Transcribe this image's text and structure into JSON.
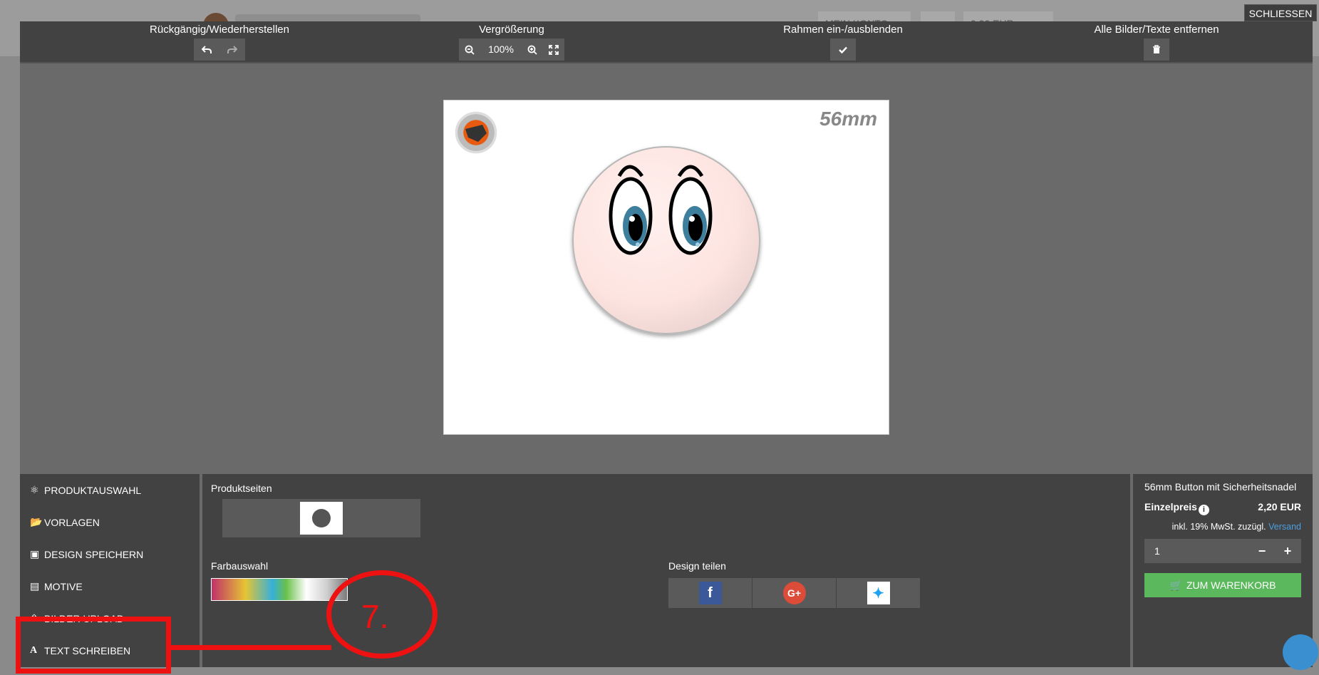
{
  "site": {
    "nav_account": "MEIN KONTO",
    "nav_cart": "0,00 EUR"
  },
  "close_label": "SCHLIESSEN",
  "toolbar": {
    "undo_redo_label": "Rückgängig/Wiederherstellen",
    "zoom_label": "Vergrößerung",
    "zoom_value": "100%",
    "frame_label": "Rahmen ein-/ausblenden",
    "clear_label": "Alle Bilder/Texte entfernen"
  },
  "canvas": {
    "size_label": "56mm"
  },
  "menu": {
    "items": [
      {
        "label": "PRODUKTAUSWAHL",
        "icon": "cubes-icon"
      },
      {
        "label": "VORLAGEN",
        "icon": "folder-open-icon"
      },
      {
        "label": "DESIGN SPEICHERN",
        "icon": "floppy-icon"
      },
      {
        "label": "MOTIVE",
        "icon": "image-icon"
      },
      {
        "label": "BILDER UPLOAD",
        "icon": "upload-icon"
      },
      {
        "label": "TEXT SCHREIBEN",
        "icon": "font-icon"
      }
    ]
  },
  "middle": {
    "pages_label": "Produktseiten",
    "color_label": "Farbauswahl",
    "share_label": "Design teilen",
    "share_buttons": [
      "facebook-icon",
      "google-plus-icon",
      "twitter-icon"
    ]
  },
  "product": {
    "title": "56mm Button mit Sicherheitsnadel",
    "price_label": "Einzelpreis",
    "price": "2,20 EUR",
    "tax_text": "inkl. 19% MwSt. zuzügl.",
    "shipping_link": "Versand",
    "quantity": "1",
    "cart_button": "ZUM WARENKORB"
  },
  "annotation": {
    "step": "7."
  },
  "colors": {
    "panel": "#424242",
    "canvas_bg": "#6a6a6a",
    "cart_green": "#5cb85c",
    "annotation_red": "#ee1111",
    "link_blue": "#4a9fdf"
  }
}
